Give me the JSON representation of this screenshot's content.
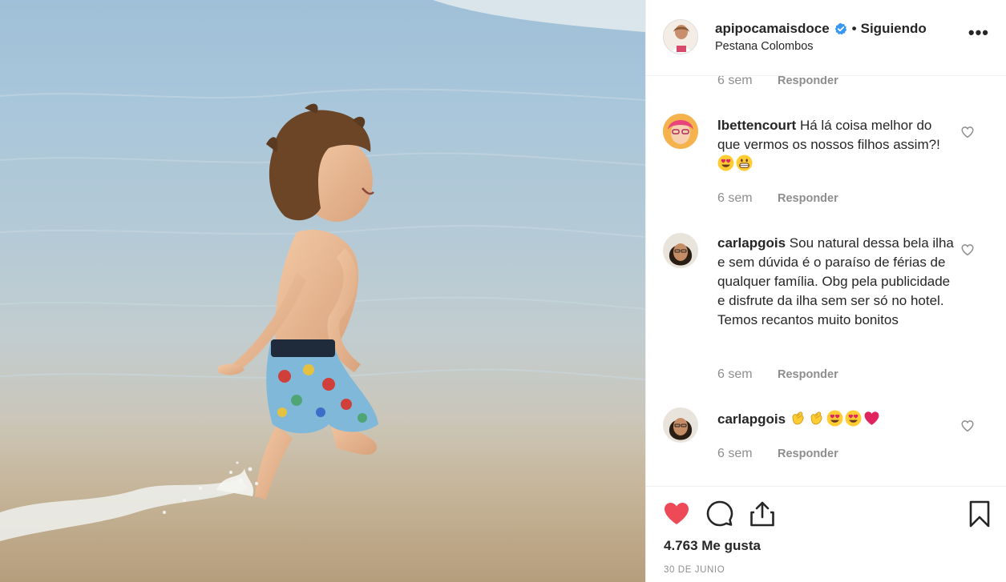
{
  "post": {
    "username": "apipocamaisdoce",
    "separator": "•",
    "follow_label": "Siguiendo",
    "location": "Pestana Colombos",
    "more_label": "•••"
  },
  "comments": [
    {
      "time": "6 sem",
      "reply_label": "Responder"
    },
    {
      "username": "lbettencourt",
      "text": "Há lá coisa melhor do que vermos os nossos filhos assim?!",
      "emojis": [
        "heart-eyes",
        "grin"
      ],
      "time": "6 sem",
      "reply_label": "Responder"
    },
    {
      "username": "carlapgois",
      "text": "Sou natural dessa bela ilha e sem dúvida é o paraíso de férias de qualquer família. Obg pela publicidade e disfrute da ilha sem ser só no hotel. Temos recantos muito bonitos",
      "time": "6 sem",
      "reply_label": "Responder"
    },
    {
      "username": "carlapgois",
      "text": "",
      "emojis": [
        "clap",
        "clap",
        "heart-eyes",
        "heart-eyes",
        "red-heart"
      ],
      "time": "6 sem",
      "reply_label": "Responder"
    }
  ],
  "footer": {
    "likes": "4.763 Me gusta",
    "date": "30 DE JUNIO"
  },
  "icons": {
    "like": "heart-filled-icon",
    "comment": "comment-bubble-icon",
    "share": "share-icon",
    "save": "bookmark-icon"
  },
  "colors": {
    "like_red": "#ed4956",
    "verified_blue": "#3897f0",
    "muted_text": "#8e8e8e"
  }
}
